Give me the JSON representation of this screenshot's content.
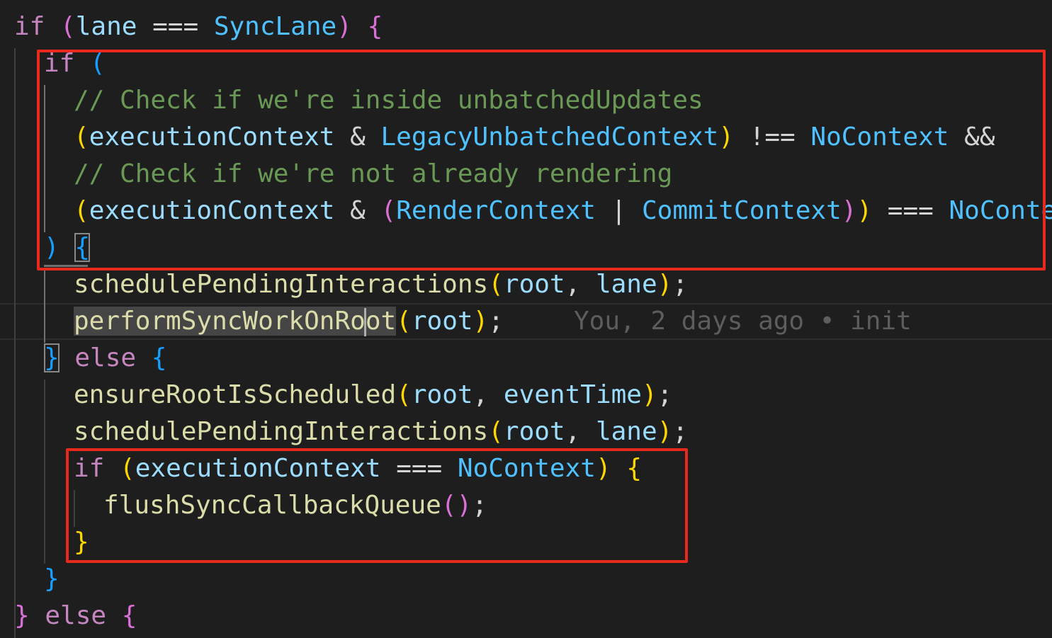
{
  "code": {
    "l0": {
      "if": "if",
      "p_open": "(",
      "lane": "lane",
      "eq": " === ",
      "synclane": "SyncLane",
      "p_close": ")",
      "brace": "{"
    },
    "l1": {
      "if": "if",
      "p_open": "("
    },
    "l2": {
      "comment": "// Check if we're inside unbatchedUpdates"
    },
    "l3": {
      "p_open": "(",
      "ctx": "executionContext",
      "amp": " & ",
      "legacy": "LegacyUnbatchedContext",
      "p_close": ")",
      "neq": " !== ",
      "nocontext": "NoContext",
      "and": " &&"
    },
    "l4": {
      "comment": "// Check if we're not already rendering"
    },
    "l5": {
      "p_open": "(",
      "ctx": "executionContext",
      "amp": " & ",
      "p_inner_open": "(",
      "render": "RenderContext",
      "pipe": " | ",
      "commit": "CommitContext",
      "p_inner_close": ")",
      "p_close": ")",
      "eq": " === ",
      "nocontext": "NoContext"
    },
    "l6": {
      "p_close": ")",
      "brace": "{"
    },
    "l7": {
      "fn": "schedulePendingInteractions",
      "p_open": "(",
      "root": "root",
      "comma": ", ",
      "lane": "lane",
      "p_close": ")",
      "semi": ";"
    },
    "l8": {
      "fn_a": "performSyncWorkOnRo",
      "fn_b": "ot",
      "p_open": "(",
      "root": "root",
      "p_close": ")",
      "semi": ";"
    },
    "l9": {
      "brace_close": "}",
      "else": "else",
      "brace": "{"
    },
    "l10": {
      "fn": "ensureRootIsScheduled",
      "p_open": "(",
      "root": "root",
      "comma": ", ",
      "eventtime": "eventTime",
      "p_close": ")",
      "semi": ";"
    },
    "l11": {
      "fn": "schedulePendingInteractions",
      "p_open": "(",
      "root": "root",
      "comma": ", ",
      "lane": "lane",
      "p_close": ")",
      "semi": ";"
    },
    "l12": {
      "if": "if",
      "p_open": "(",
      "ctx": "executionContext",
      "eq": " === ",
      "nocontext": "NoContext",
      "p_close": ")",
      "brace": "{"
    },
    "l13": {
      "fn": "flushSyncCallbackQueue",
      "parens": "()",
      "semi": ";"
    },
    "l14": {
      "brace_close": "}"
    },
    "l15": {
      "brace_close": "}"
    },
    "l16": {
      "brace_close": "}",
      "else": "else",
      "brace": "{"
    }
  },
  "blame": "You, 2 days ago • init",
  "colors": {
    "background": "#1e1e1e",
    "keyword": "#c586c0",
    "variable": "#9cdcfe",
    "constant": "#4fc1ff",
    "function": "#dcdcaa",
    "comment": "#6a9955",
    "bracket_gold": "#ffd700",
    "bracket_orchid": "#da70d6",
    "bracket_blue": "#179fff",
    "annotation_red": "#e8291c"
  }
}
